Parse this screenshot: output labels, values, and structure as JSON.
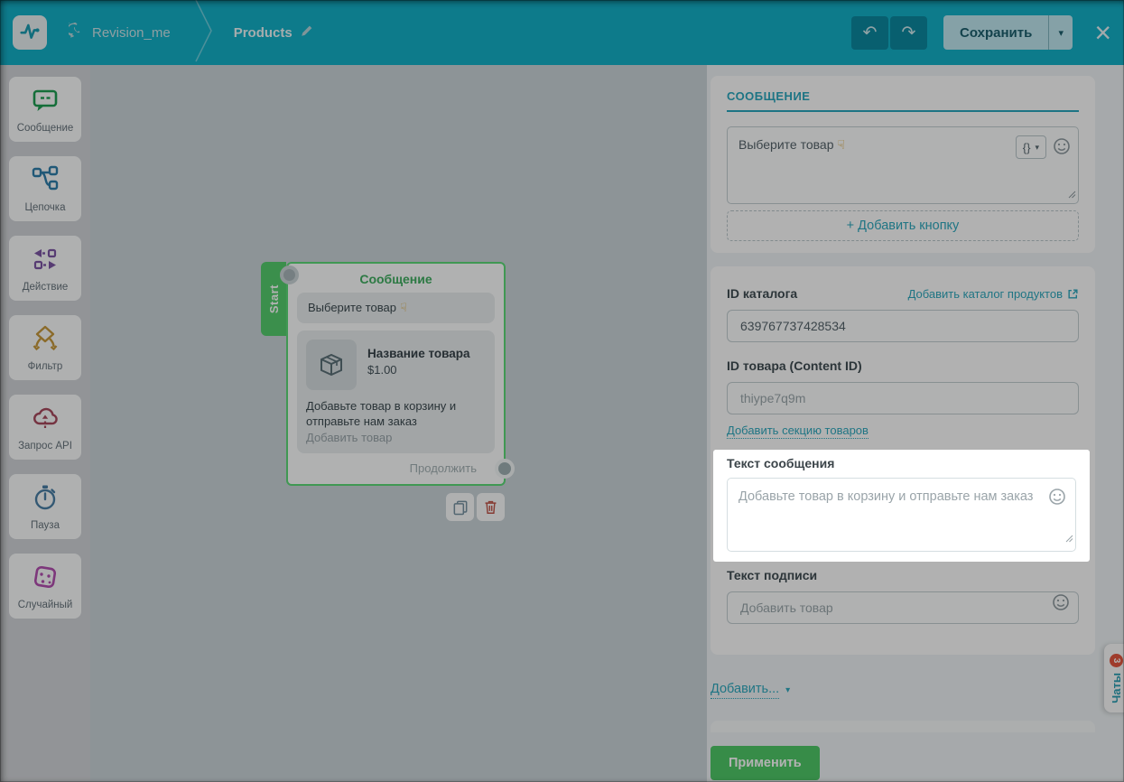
{
  "icons": {
    "caret_down": "▾",
    "undo": "↶",
    "redo": "↷",
    "close": "×",
    "hand_down": "☟",
    "variables": "{}"
  },
  "colors": {
    "accent_teal": "#13b0c8",
    "link_teal": "#2ea8bd",
    "success_green": "#4fc968",
    "node_green": "#5cda78",
    "danger_red": "#c0564a",
    "badge_red": "#e4573f"
  },
  "header": {
    "workspace": "Revision_me",
    "page": "Products",
    "save_label": "Сохранить"
  },
  "sidebar": {
    "items": [
      {
        "icon": "message-icon",
        "label": "Сообщение"
      },
      {
        "icon": "chain-icon",
        "label": "Цепочка"
      },
      {
        "icon": "action-icon",
        "label": "Действие"
      },
      {
        "icon": "filter-icon",
        "label": "Фильтр"
      },
      {
        "icon": "api-request-icon",
        "label": "Запрос API"
      },
      {
        "icon": "pause-icon",
        "label": "Пауза"
      },
      {
        "icon": "random-icon",
        "label": "Случайный"
      }
    ]
  },
  "canvas": {
    "node": {
      "start_label": "Start",
      "title": "Сообщение",
      "bubble_text": "Выберите товар",
      "product_name": "Название товара",
      "product_price": "$1.00",
      "description": "Добавьте товар в корзину и отправьте нам заказ",
      "add_product_label": "Добавить товар",
      "continue_label": "Продолжить"
    }
  },
  "panel": {
    "section_title": "СООБЩЕНИЕ",
    "message": {
      "value": "Выберите товар"
    },
    "add_button_label": "+ Добавить кнопку",
    "catalog": {
      "label": "ID каталога",
      "link": "Добавить каталог продуктов",
      "value": "639767737428534"
    },
    "content": {
      "label": "ID товара (Content ID)",
      "value": "thiype7q9m"
    },
    "add_section_link": "Добавить секцию товаров",
    "message_text": {
      "label": "Текст сообщения",
      "value": "Добавьте товар в корзину и отправьте нам заказ"
    },
    "caption": {
      "label": "Текст подписи",
      "value": "Добавить товар"
    },
    "add_more_label": "Добавить...",
    "apply_label": "Применить"
  },
  "chats": {
    "label": "Чаты",
    "badge": "3"
  }
}
